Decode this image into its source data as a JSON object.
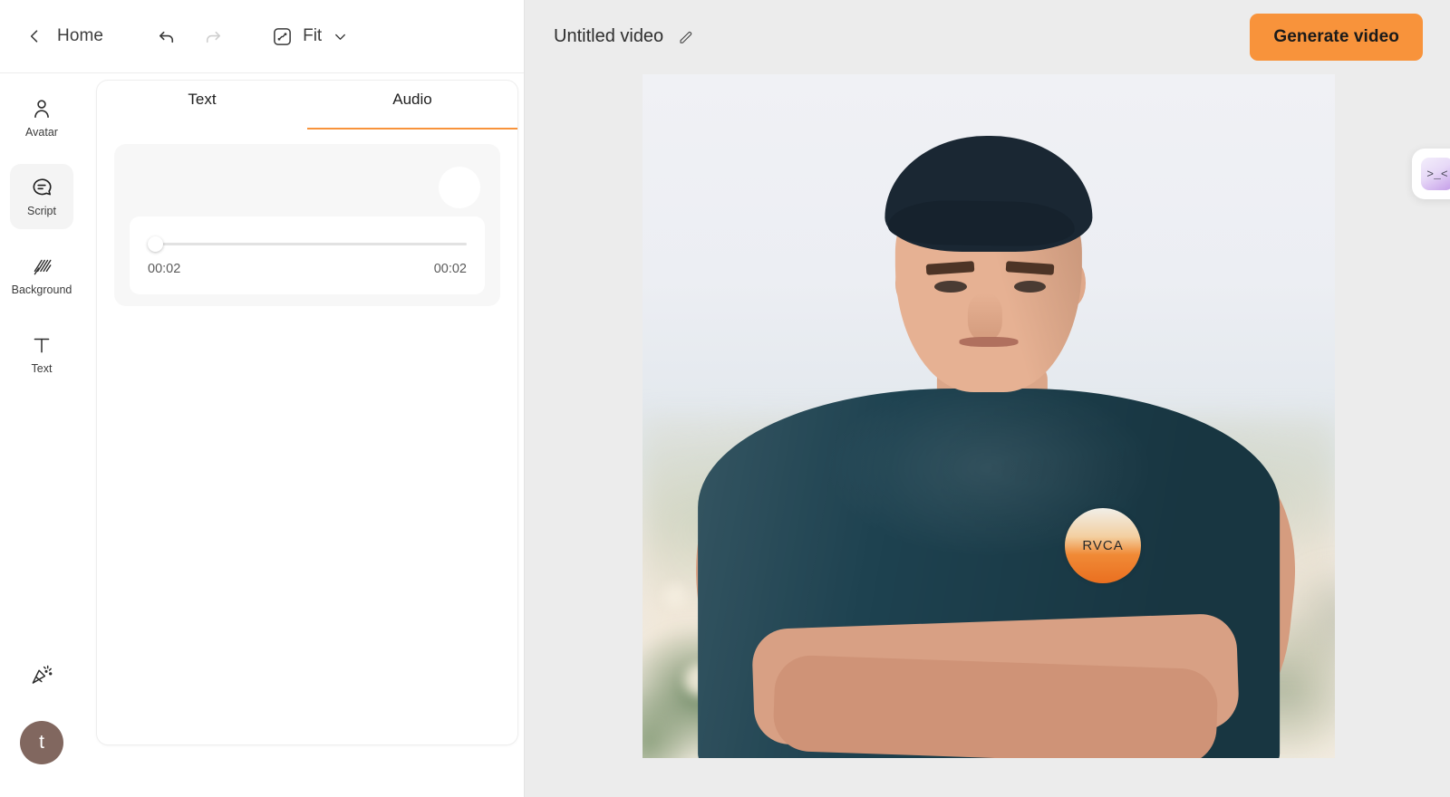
{
  "accent_color": "#f8933b",
  "toolbar": {
    "back_label": "Home",
    "zoom_label": "Fit",
    "undo_icon": "undo-icon",
    "redo_icon": "redo-icon",
    "fit_icon": "fit-screen-icon",
    "chevron_icon": "chevron-down-icon"
  },
  "rail": {
    "items": [
      {
        "label": "Avatar",
        "icon": "person-icon",
        "active": false
      },
      {
        "label": "Script",
        "icon": "speech-bubble-icon",
        "active": true
      },
      {
        "label": "Background",
        "icon": "hatch-pattern-icon",
        "active": false
      },
      {
        "label": "Text",
        "icon": "text-t-icon",
        "active": false
      }
    ],
    "celebrate_icon": "party-popper-icon",
    "user_initial": "t",
    "user_avatar_color": "#81675f"
  },
  "panel": {
    "tabs": [
      {
        "label": "Text",
        "active": false
      },
      {
        "label": "Audio",
        "active": true
      }
    ],
    "audio": {
      "current_time": "00:02",
      "total_time": "00:02",
      "progress_percent": 0,
      "play_button_icon": "play-icon"
    }
  },
  "stage": {
    "video_title": "Untitled video",
    "edit_title_icon": "pencil-icon",
    "generate_button_label": "Generate video",
    "canvas": {
      "shirt_logo_text": "RVCA"
    },
    "float_widget": {
      "face_text": ">_<",
      "icon": "kaomoji-face-icon"
    }
  }
}
